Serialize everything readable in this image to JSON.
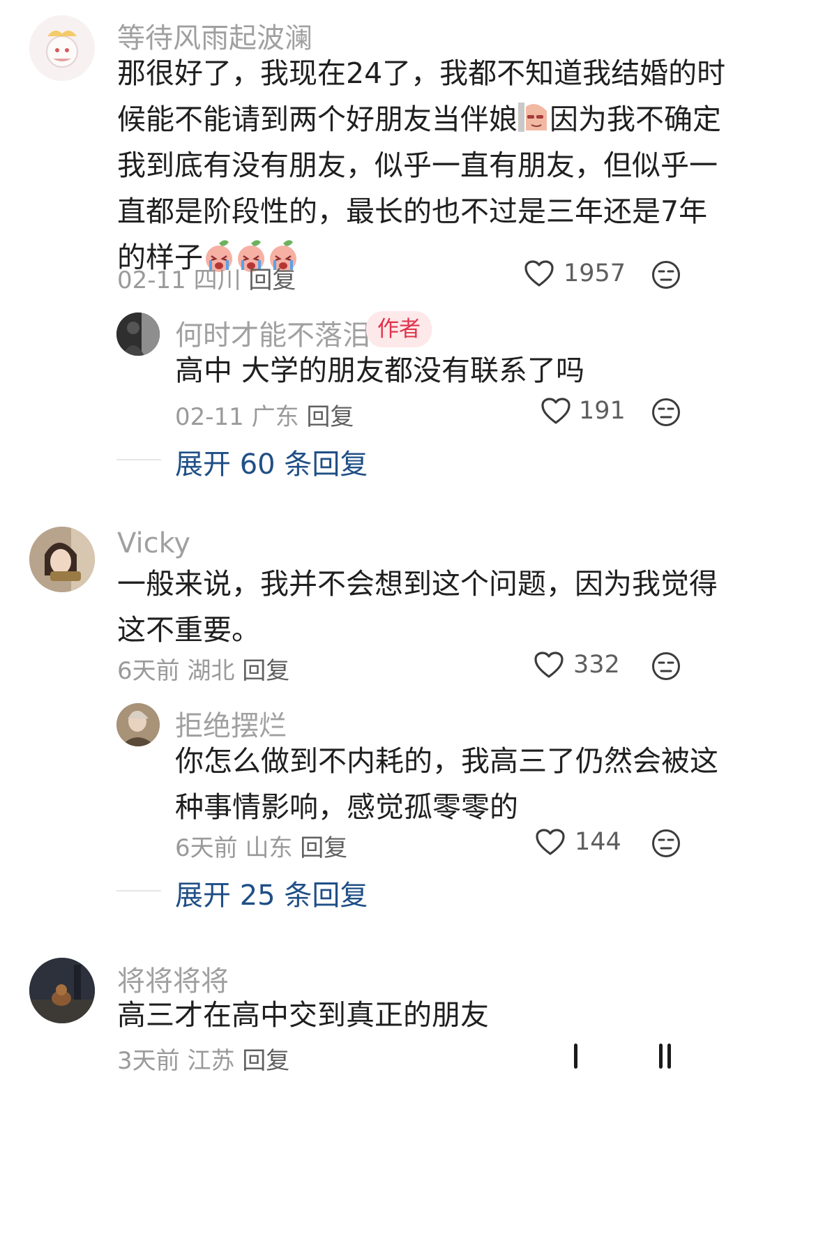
{
  "comments": [
    {
      "user": "等待风雨起波澜",
      "lines": [
        "那很好了，我现在24了，我都不知道我结婚的时",
        "候能不能请到两个好朋友当伴娘",
        "因为我不确定",
        "我到底有没有朋友，似乎一直有朋友，但似乎一",
        "直都是阶段性的，最长的也不过是三年还是7年",
        "的样子"
      ],
      "time": "02-11",
      "location": "四川",
      "reply": "回复",
      "likes": "1957"
    },
    {
      "user": "何时才能不落泪",
      "badge": "作者",
      "lines": [
        "高中 大学的朋友都没有联系了吗"
      ],
      "time": "02-11",
      "location": "广东",
      "reply": "回复",
      "likes": "191",
      "expand": "展开 60 条回复"
    },
    {
      "user": "Vicky",
      "lines": [
        "一般来说，我并不会想到这个问题，因为我觉得",
        "这不重要。"
      ],
      "time": "6天前",
      "location": "湖北",
      "reply": "回复",
      "likes": "332"
    },
    {
      "user": "拒绝摆烂",
      "lines": [
        "你怎么做到不内耗的，我高三了仍然会被这",
        "种事情影响，感觉孤零零的"
      ],
      "time": "6天前",
      "location": "山东",
      "reply": "回复",
      "likes": "144",
      "expand": "展开 25 条回复"
    },
    {
      "user": "将将将将",
      "lines": [
        "高三才在高中交到真正的朋友"
      ],
      "time": "3天前",
      "location": "江苏",
      "reply": "回复"
    }
  ],
  "icons": {
    "like": "heart-outline-icon",
    "dislike": "unamused-face-icon",
    "emoji_sticker": "peach-sticker-icon"
  },
  "colors": {
    "name": "#a0a0a0",
    "expand_link": "#1f4f86",
    "author_badge_bg": "#fde8ea",
    "author_badge_text": "#e0324b"
  }
}
